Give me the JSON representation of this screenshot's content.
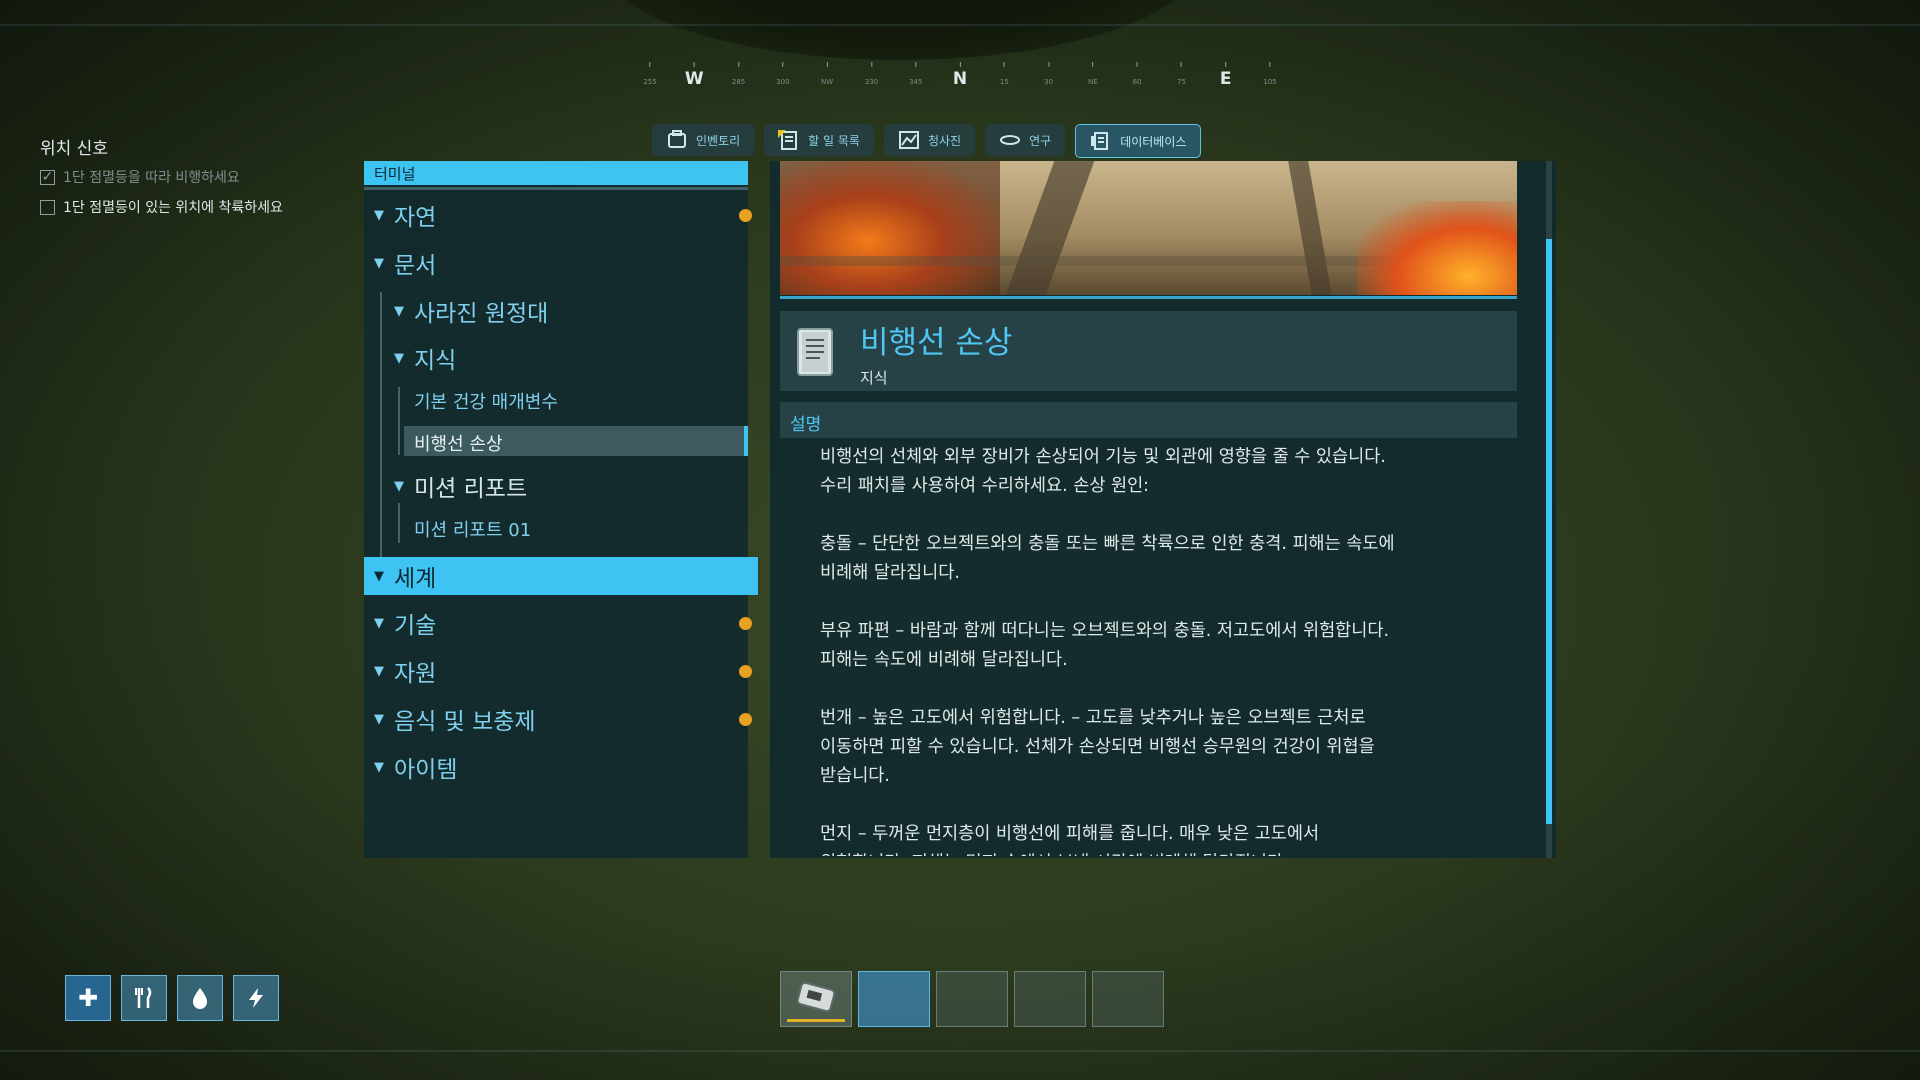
{
  "compass": {
    "items": [
      {
        "label": "255",
        "type": "minor"
      },
      {
        "label": "W",
        "type": "major"
      },
      {
        "label": "285",
        "type": "minor"
      },
      {
        "label": "300",
        "type": "minor"
      },
      {
        "label": "NW",
        "type": "minor"
      },
      {
        "label": "330",
        "type": "minor"
      },
      {
        "label": "345",
        "type": "minor"
      },
      {
        "label": "N",
        "type": "major"
      },
      {
        "label": "15",
        "type": "minor"
      },
      {
        "label": "30",
        "type": "minor"
      },
      {
        "label": "NE",
        "type": "minor"
      },
      {
        "label": "60",
        "type": "minor"
      },
      {
        "label": "75",
        "type": "minor"
      },
      {
        "label": "E",
        "type": "major"
      },
      {
        "label": "105",
        "type": "minor"
      }
    ]
  },
  "objectives": {
    "title": "위치 신호",
    "items": [
      {
        "text": "1단 점멸등을 따라 비행하세요",
        "done": true
      },
      {
        "text": "1단 점멸등이 있는 위치에 착륙하세요",
        "done": false
      }
    ]
  },
  "tabs": [
    {
      "label": "인벤토리",
      "icon": "inventory-icon",
      "active": false
    },
    {
      "label": "할 일 목록",
      "icon": "task-list-icon",
      "active": false
    },
    {
      "label": "청사진",
      "icon": "blueprint-icon",
      "active": false
    },
    {
      "label": "연구",
      "icon": "research-icon",
      "active": false
    },
    {
      "label": "데이터베이스",
      "icon": "database-icon",
      "active": true
    }
  ],
  "terminal": {
    "header": "터미널",
    "tree": [
      {
        "label": "자연",
        "level": 0,
        "dot": true
      },
      {
        "label": "문서",
        "level": 0,
        "dot": false
      },
      {
        "label": "사라진 원정대",
        "level": 1,
        "dot": false
      },
      {
        "label": "지식",
        "level": 1,
        "dot": false
      },
      {
        "label": "기본 건강 매개변수",
        "level": 2,
        "leaf": true
      },
      {
        "label": "비행선 손상",
        "level": 2,
        "leaf": true,
        "selected": true
      },
      {
        "label": "미션 리포트",
        "level": 1,
        "dot": false
      },
      {
        "label": "미션 리포트 01",
        "level": 2,
        "leaf": true
      },
      {
        "label": "세계",
        "level": 0,
        "selected": true
      },
      {
        "label": "기술",
        "level": 0,
        "dot": true
      },
      {
        "label": "자원",
        "level": 0,
        "dot": true
      },
      {
        "label": "음식 및 보충제",
        "level": 0,
        "dot": true
      },
      {
        "label": "아이템",
        "level": 0,
        "dot": false
      }
    ]
  },
  "entry": {
    "title": "비행선 손상",
    "category": "지식",
    "description_label": "설명",
    "description": "비행선의 선체와 외부 장비가 손상되어 기능 및 외관에 영향을 줄 수 있습니다.\n수리 패치를 사용하여 수리하세요. 손상 원인:\n\n충돌 – 단단한 오브젝트와의 충돌 또는 빠른 착륙으로 인한 충격. 피해는 속도에\n비례해 달라집니다.\n\n부유 파편 – 바람과 함께 떠다니는 오브젝트와의 충돌. 저고도에서 위험합니다.\n피해는 속도에 비례해 달라집니다.\n\n번개 – 높은 고도에서 위험합니다. – 고도를 낮추거나 높은 오브젝트 근처로\n이동하면 피할 수 있습니다. 선체가 손상되면 비행선 승무원의 건강이 위협을\n받습니다.\n\n먼지 – 두꺼운 먼지층이 비행선에 피해를 줍니다. 매우 낮은 고도에서\n위험합니다. 피해는 먼지 속에서 보낸 시간에 비례해 달라집니다."
  },
  "status": [
    {
      "icon": "health-icon",
      "glyph": "✚"
    },
    {
      "icon": "food-icon",
      "glyph": "🍴"
    },
    {
      "icon": "water-icon",
      "glyph": "💧"
    },
    {
      "icon": "energy-icon",
      "glyph": "⚡"
    }
  ],
  "hotbar": {
    "slots": [
      {
        "item": "repair-kit-icon",
        "filled": true,
        "active": false
      },
      {
        "item": "",
        "filled": false,
        "active": true
      },
      {
        "item": "",
        "filled": false,
        "active": false
      },
      {
        "item": "",
        "filled": false,
        "active": false
      },
      {
        "item": "",
        "filled": false,
        "active": false
      }
    ]
  },
  "colors": {
    "accent": "#3ec4f3",
    "panel": "#122a2e",
    "dot": "#e7a21f"
  }
}
